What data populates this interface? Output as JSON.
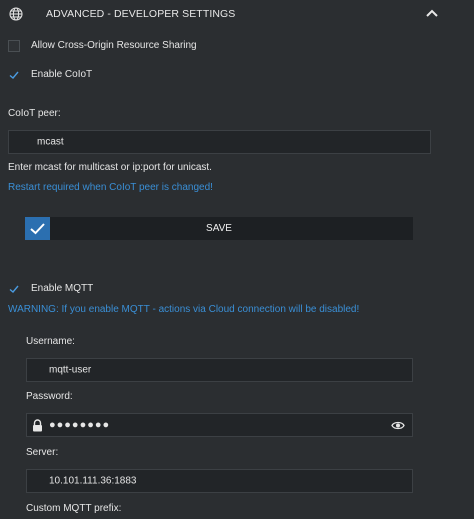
{
  "header": {
    "title": "ADVANCED - DEVELOPER SETTINGS",
    "icon": "globe-icon",
    "collapse_icon": "chevron-up-icon"
  },
  "cors": {
    "label": "Allow Cross-Origin Resource Sharing",
    "checked": false
  },
  "coiot": {
    "label": "Enable CoIoT",
    "checked": true
  },
  "coiot_peer": {
    "label": "CoIoT peer:",
    "value": "mcast",
    "hint": "Enter mcast for multicast or ip:port for unicast.",
    "restart_note": "Restart required when CoIoT peer is changed!"
  },
  "save": {
    "label": "SAVE"
  },
  "mqtt": {
    "label": "Enable MQTT",
    "checked": true,
    "warning": "WARNING: If you enable MQTT - actions via Cloud connection will be disabled!",
    "username_label": "Username:",
    "username": "mqtt-user",
    "password_label": "Password:",
    "password_masked": "●●●●●●●●",
    "server_label": "Server:",
    "server": "10.101.111.36:1883",
    "prefix_label": "Custom MQTT prefix:"
  },
  "colors": {
    "accent": "#3a8fd6",
    "background": "#2b2e31",
    "save_check": "#2b6fb0"
  }
}
